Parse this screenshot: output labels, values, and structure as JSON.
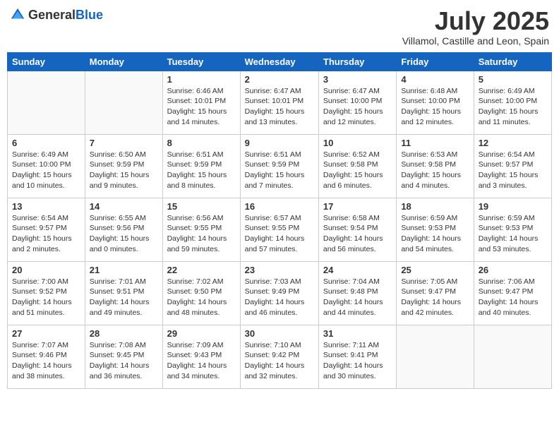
{
  "header": {
    "logo_general": "General",
    "logo_blue": "Blue",
    "month_year": "July 2025",
    "location": "Villamol, Castille and Leon, Spain"
  },
  "weekdays": [
    "Sunday",
    "Monday",
    "Tuesday",
    "Wednesday",
    "Thursday",
    "Friday",
    "Saturday"
  ],
  "weeks": [
    [
      {
        "day": "",
        "sunrise": "",
        "sunset": "",
        "daylight": ""
      },
      {
        "day": "",
        "sunrise": "",
        "sunset": "",
        "daylight": ""
      },
      {
        "day": "1",
        "sunrise": "Sunrise: 6:46 AM",
        "sunset": "Sunset: 10:01 PM",
        "daylight": "Daylight: 15 hours and 14 minutes."
      },
      {
        "day": "2",
        "sunrise": "Sunrise: 6:47 AM",
        "sunset": "Sunset: 10:01 PM",
        "daylight": "Daylight: 15 hours and 13 minutes."
      },
      {
        "day": "3",
        "sunrise": "Sunrise: 6:47 AM",
        "sunset": "Sunset: 10:00 PM",
        "daylight": "Daylight: 15 hours and 12 minutes."
      },
      {
        "day": "4",
        "sunrise": "Sunrise: 6:48 AM",
        "sunset": "Sunset: 10:00 PM",
        "daylight": "Daylight: 15 hours and 12 minutes."
      },
      {
        "day": "5",
        "sunrise": "Sunrise: 6:49 AM",
        "sunset": "Sunset: 10:00 PM",
        "daylight": "Daylight: 15 hours and 11 minutes."
      }
    ],
    [
      {
        "day": "6",
        "sunrise": "Sunrise: 6:49 AM",
        "sunset": "Sunset: 10:00 PM",
        "daylight": "Daylight: 15 hours and 10 minutes."
      },
      {
        "day": "7",
        "sunrise": "Sunrise: 6:50 AM",
        "sunset": "Sunset: 9:59 PM",
        "daylight": "Daylight: 15 hours and 9 minutes."
      },
      {
        "day": "8",
        "sunrise": "Sunrise: 6:51 AM",
        "sunset": "Sunset: 9:59 PM",
        "daylight": "Daylight: 15 hours and 8 minutes."
      },
      {
        "day": "9",
        "sunrise": "Sunrise: 6:51 AM",
        "sunset": "Sunset: 9:59 PM",
        "daylight": "Daylight: 15 hours and 7 minutes."
      },
      {
        "day": "10",
        "sunrise": "Sunrise: 6:52 AM",
        "sunset": "Sunset: 9:58 PM",
        "daylight": "Daylight: 15 hours and 6 minutes."
      },
      {
        "day": "11",
        "sunrise": "Sunrise: 6:53 AM",
        "sunset": "Sunset: 9:58 PM",
        "daylight": "Daylight: 15 hours and 4 minutes."
      },
      {
        "day": "12",
        "sunrise": "Sunrise: 6:54 AM",
        "sunset": "Sunset: 9:57 PM",
        "daylight": "Daylight: 15 hours and 3 minutes."
      }
    ],
    [
      {
        "day": "13",
        "sunrise": "Sunrise: 6:54 AM",
        "sunset": "Sunset: 9:57 PM",
        "daylight": "Daylight: 15 hours and 2 minutes."
      },
      {
        "day": "14",
        "sunrise": "Sunrise: 6:55 AM",
        "sunset": "Sunset: 9:56 PM",
        "daylight": "Daylight: 15 hours and 0 minutes."
      },
      {
        "day": "15",
        "sunrise": "Sunrise: 6:56 AM",
        "sunset": "Sunset: 9:55 PM",
        "daylight": "Daylight: 14 hours and 59 minutes."
      },
      {
        "day": "16",
        "sunrise": "Sunrise: 6:57 AM",
        "sunset": "Sunset: 9:55 PM",
        "daylight": "Daylight: 14 hours and 57 minutes."
      },
      {
        "day": "17",
        "sunrise": "Sunrise: 6:58 AM",
        "sunset": "Sunset: 9:54 PM",
        "daylight": "Daylight: 14 hours and 56 minutes."
      },
      {
        "day": "18",
        "sunrise": "Sunrise: 6:59 AM",
        "sunset": "Sunset: 9:53 PM",
        "daylight": "Daylight: 14 hours and 54 minutes."
      },
      {
        "day": "19",
        "sunrise": "Sunrise: 6:59 AM",
        "sunset": "Sunset: 9:53 PM",
        "daylight": "Daylight: 14 hours and 53 minutes."
      }
    ],
    [
      {
        "day": "20",
        "sunrise": "Sunrise: 7:00 AM",
        "sunset": "Sunset: 9:52 PM",
        "daylight": "Daylight: 14 hours and 51 minutes."
      },
      {
        "day": "21",
        "sunrise": "Sunrise: 7:01 AM",
        "sunset": "Sunset: 9:51 PM",
        "daylight": "Daylight: 14 hours and 49 minutes."
      },
      {
        "day": "22",
        "sunrise": "Sunrise: 7:02 AM",
        "sunset": "Sunset: 9:50 PM",
        "daylight": "Daylight: 14 hours and 48 minutes."
      },
      {
        "day": "23",
        "sunrise": "Sunrise: 7:03 AM",
        "sunset": "Sunset: 9:49 PM",
        "daylight": "Daylight: 14 hours and 46 minutes."
      },
      {
        "day": "24",
        "sunrise": "Sunrise: 7:04 AM",
        "sunset": "Sunset: 9:48 PM",
        "daylight": "Daylight: 14 hours and 44 minutes."
      },
      {
        "day": "25",
        "sunrise": "Sunrise: 7:05 AM",
        "sunset": "Sunset: 9:47 PM",
        "daylight": "Daylight: 14 hours and 42 minutes."
      },
      {
        "day": "26",
        "sunrise": "Sunrise: 7:06 AM",
        "sunset": "Sunset: 9:47 PM",
        "daylight": "Daylight: 14 hours and 40 minutes."
      }
    ],
    [
      {
        "day": "27",
        "sunrise": "Sunrise: 7:07 AM",
        "sunset": "Sunset: 9:46 PM",
        "daylight": "Daylight: 14 hours and 38 minutes."
      },
      {
        "day": "28",
        "sunrise": "Sunrise: 7:08 AM",
        "sunset": "Sunset: 9:45 PM",
        "daylight": "Daylight: 14 hours and 36 minutes."
      },
      {
        "day": "29",
        "sunrise": "Sunrise: 7:09 AM",
        "sunset": "Sunset: 9:43 PM",
        "daylight": "Daylight: 14 hours and 34 minutes."
      },
      {
        "day": "30",
        "sunrise": "Sunrise: 7:10 AM",
        "sunset": "Sunset: 9:42 PM",
        "daylight": "Daylight: 14 hours and 32 minutes."
      },
      {
        "day": "31",
        "sunrise": "Sunrise: 7:11 AM",
        "sunset": "Sunset: 9:41 PM",
        "daylight": "Daylight: 14 hours and 30 minutes."
      },
      {
        "day": "",
        "sunrise": "",
        "sunset": "",
        "daylight": ""
      },
      {
        "day": "",
        "sunrise": "",
        "sunset": "",
        "daylight": ""
      }
    ]
  ]
}
